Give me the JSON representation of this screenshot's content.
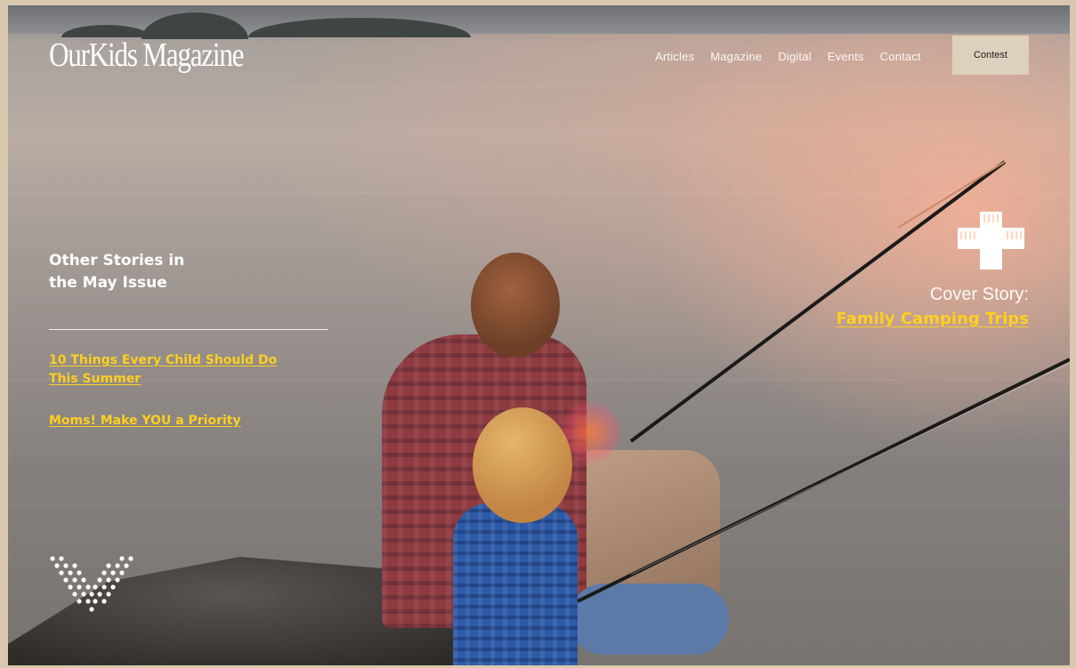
{
  "site": {
    "logo_text": "OurKids Magazine"
  },
  "nav": {
    "items": [
      {
        "label": "Articles"
      },
      {
        "label": "Magazine"
      },
      {
        "label": "Digital"
      },
      {
        "label": "Events"
      },
      {
        "label": "Contact"
      }
    ],
    "cta_label": "Contest"
  },
  "sidebar": {
    "heading_line1": "Other Stories in",
    "heading_line2": "the May Issue",
    "stories": [
      {
        "title": "10 Things Every Child Should Do This Summer"
      },
      {
        "title": "Moms! Make YOU a Priority"
      }
    ]
  },
  "cover": {
    "label": "Cover Story:",
    "title": "Family Camping Trips",
    "icon": "cross-icon"
  },
  "decor": {
    "scroll_icon": "chevron-down-dots-icon",
    "hero_image": "father-and-son-fishing-at-lake"
  },
  "colors": {
    "accent": "#ffcf1f",
    "contest_bg": "#ddd0bd",
    "frame": "#d8c8ae"
  }
}
